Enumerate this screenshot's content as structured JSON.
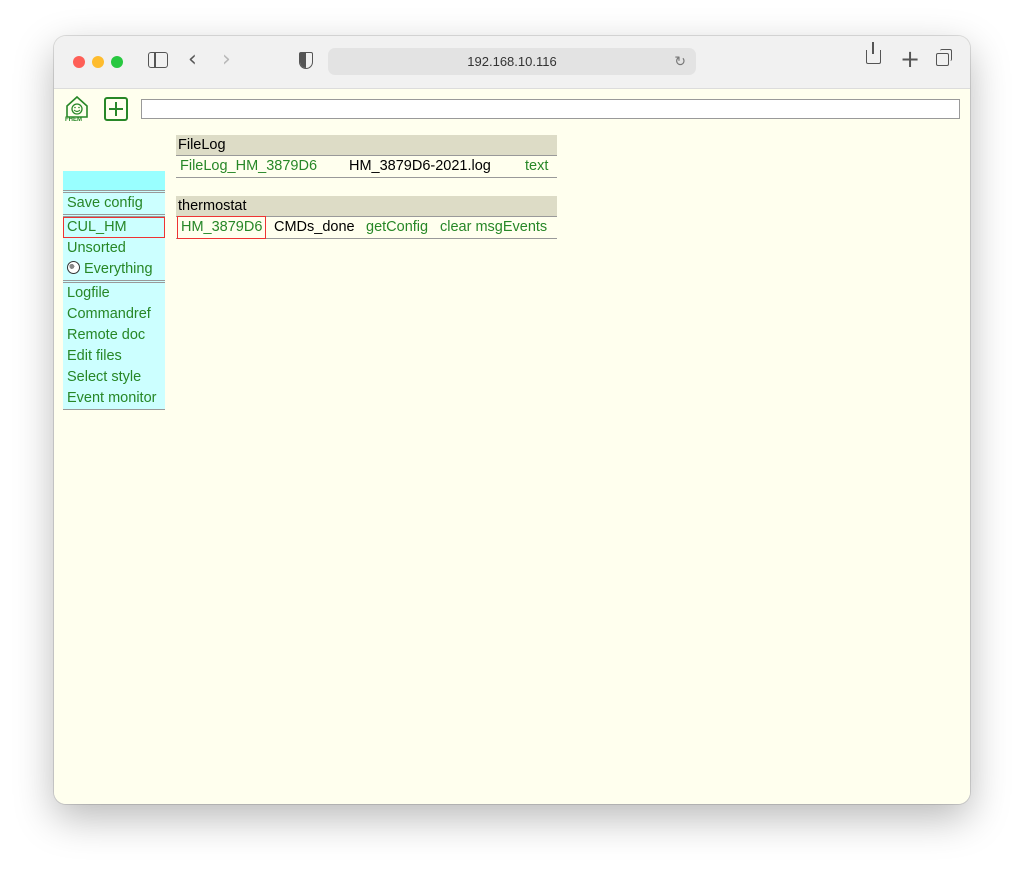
{
  "browser": {
    "url": "192.168.10.116"
  },
  "toolbar": {
    "logo_text": "FHEM",
    "command_input": ""
  },
  "menu": {
    "items": [
      "Save config",
      "CUL_HM",
      "Unsorted",
      "Everything",
      "Logfile",
      "Commandref",
      "Remote doc",
      "Edit files",
      "Select style",
      "Event monitor"
    ],
    "selected": "CUL_HM"
  },
  "filelog": {
    "title": "FileLog",
    "row": {
      "device": "FileLog_HM_3879D6",
      "file": "HM_3879D6-2021.log",
      "action": "text"
    }
  },
  "thermostat": {
    "title": "thermostat",
    "row": {
      "device": "HM_3879D6",
      "state": "CMDs_done",
      "cmd1": "getConfig",
      "cmd2": "clear msgEvents"
    }
  },
  "colors": {
    "page_bg": "#ffffee",
    "menu_bg": "#ccffff",
    "menu_head": "#99ffff",
    "link": "#278727",
    "block_head": "#dddcc6",
    "selected_outline": "#ee3333"
  }
}
